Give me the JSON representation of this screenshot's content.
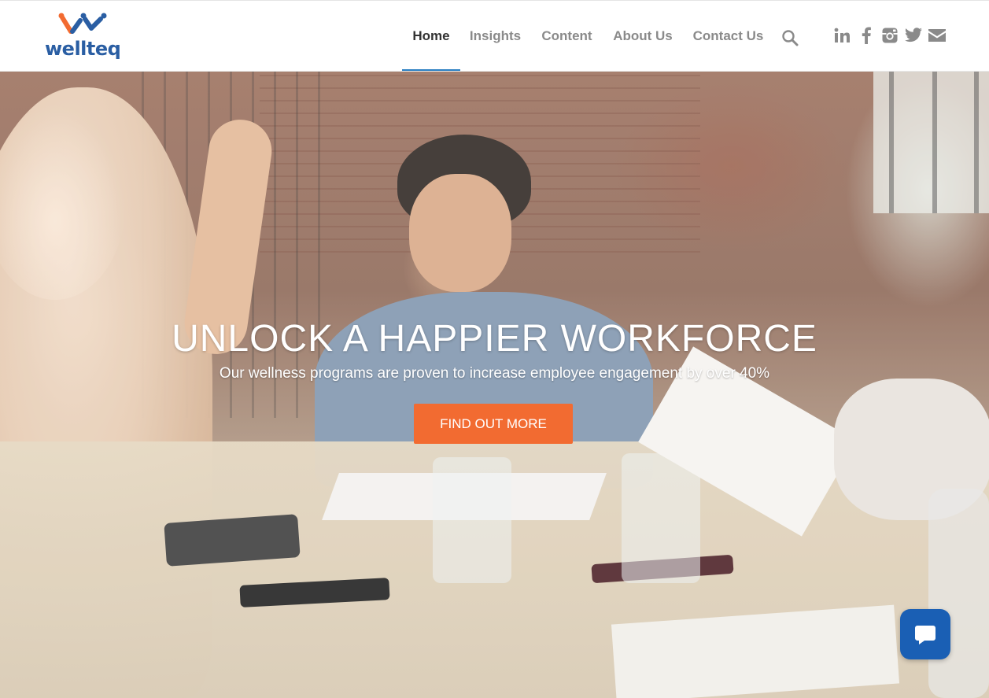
{
  "brand": {
    "name": "wellteq",
    "logo_icon": "wellteq-logo-mark",
    "colors": {
      "blue": "#2a5ea3",
      "orange": "#f26b31"
    }
  },
  "nav": {
    "items": [
      {
        "label": "Home",
        "active": true
      },
      {
        "label": "Insights",
        "active": false
      },
      {
        "label": "Content",
        "active": false
      },
      {
        "label": "About Us",
        "active": false
      },
      {
        "label": "Contact Us",
        "active": false
      }
    ],
    "search_icon": "search-icon",
    "accent": "#2b7fc2"
  },
  "social": [
    "linkedin-icon",
    "facebook-icon",
    "instagram-icon",
    "twitter-icon",
    "mail-icon"
  ],
  "hero": {
    "title": "UNLOCK A HAPPIER WORKFORCE",
    "subtitle": "Our wellness programs are proven to increase employee engagement by over 40%",
    "cta_label": "FIND OUT MORE"
  },
  "chat": {
    "icon": "chat-bubble-icon",
    "color": "#1a5fb4"
  }
}
